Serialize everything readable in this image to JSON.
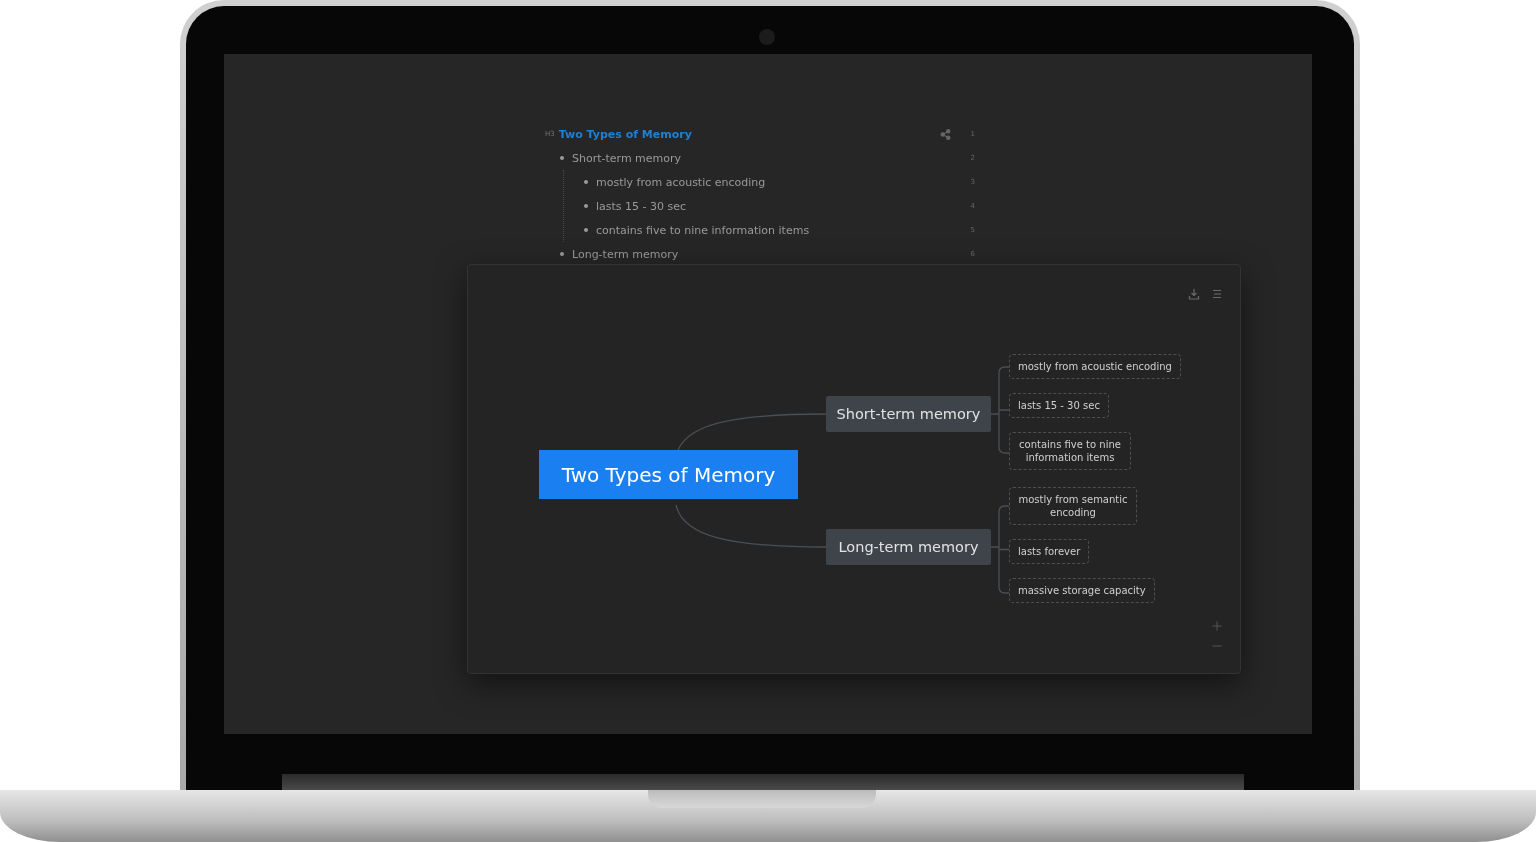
{
  "outline": {
    "heading_tag": "H3",
    "title": "Two Types of Memory",
    "title_line": "1",
    "items": [
      {
        "text": "Short-term memory",
        "line": "2",
        "children": [
          {
            "text": "mostly from acoustic encoding",
            "line": "3"
          },
          {
            "text": "lasts 15 - 30 sec",
            "line": "4"
          },
          {
            "text": "contains five to nine information items",
            "line": "5"
          }
        ]
      },
      {
        "text": "Long-term memory",
        "line": "6"
      }
    ]
  },
  "mindmap": {
    "root": "Two Types of Memory",
    "branches": [
      {
        "label": "Short-term memory",
        "children": [
          "mostly from acoustic encoding",
          "lasts 15 - 30 sec",
          "contains five to nine information items"
        ]
      },
      {
        "label": "Long-term memory",
        "children": [
          "mostly from semantic encoding",
          "lasts forever",
          "massive storage capacity"
        ]
      }
    ]
  }
}
